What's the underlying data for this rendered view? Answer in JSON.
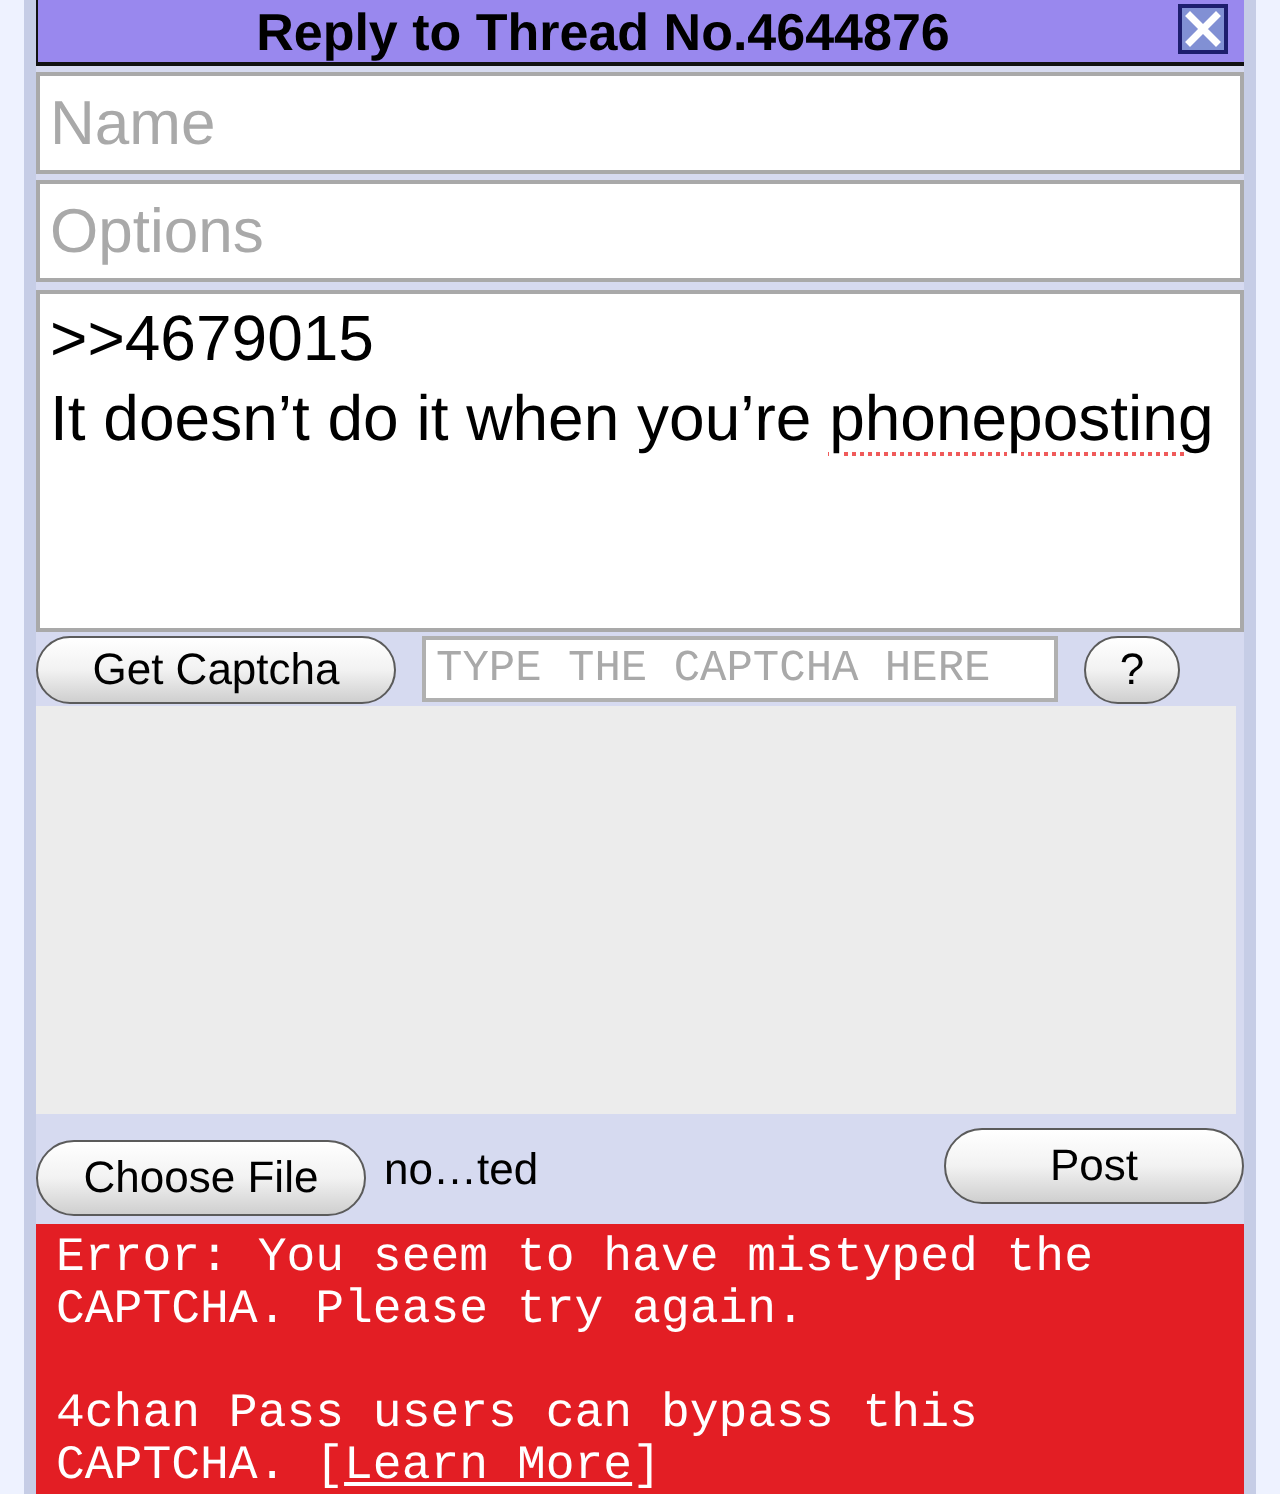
{
  "window": {
    "title": "Reply to Thread No.4644876"
  },
  "fields": [
    {
      "placeholder": "Name"
    },
    {
      "placeholder": "Options"
    }
  ],
  "message": {
    "lines": [
      {
        "segments": [
          {
            "text": ">>4679015",
            "misspelled": false
          }
        ]
      },
      {
        "segments": [
          {
            "text": "It doesn’t do it when you’re ",
            "misspelled": false
          },
          {
            "text": "phoneposting",
            "misspelled": true
          }
        ]
      }
    ]
  },
  "captcha": {
    "button": "Get Captcha",
    "placeholder": "TYPE THE CAPTCHA HERE",
    "help": "?"
  },
  "file": {
    "button": "Choose File",
    "status": "no…ted"
  },
  "post_button": "Post",
  "error": {
    "message": "Error: You seem to have mistyped the CAPTCHA. Please try again.",
    "pass_note": {
      "before": "4chan Pass users can bypass this CAPTCHA. [",
      "link": "Learn More",
      "after": "]"
    }
  }
}
